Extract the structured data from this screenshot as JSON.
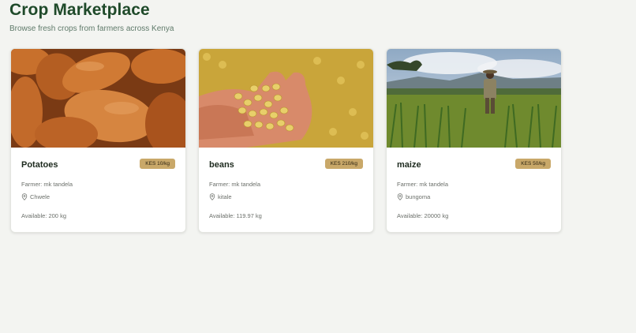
{
  "header": {
    "title": "Crop Marketplace",
    "subtitle": "Browse fresh crops from farmers across Kenya"
  },
  "listings": [
    {
      "name": "Potatoes",
      "price": "KES 10/kg",
      "farmer": "Farmer: mk tandela",
      "location": "Chwele",
      "available": "Available: 200 kg",
      "image": "sweet-potatoes-photo"
    },
    {
      "name": "beans",
      "price": "KES 210/kg",
      "farmer": "Farmer: mk tandela",
      "location": "kitale",
      "available": "Available: 119.97 kg",
      "image": "soybeans-in-hands-photo"
    },
    {
      "name": "maize",
      "price": "KES 50/kg",
      "farmer": "Farmer: mk tandela",
      "location": "bungoma",
      "available": "Available: 20000 kg",
      "image": "farmer-in-maize-field-photo"
    }
  ],
  "colors": {
    "accent": "#c9a869",
    "title": "#1f4a2a",
    "background": "#f3f4f1"
  },
  "icons": {
    "location": "map-pin-icon"
  }
}
